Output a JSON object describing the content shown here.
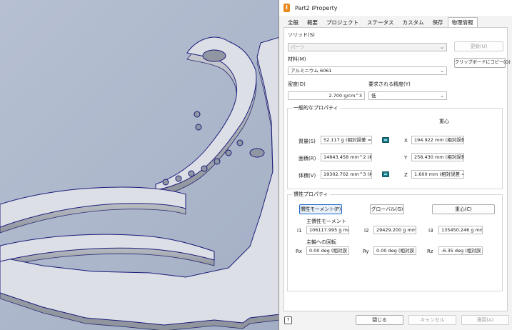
{
  "window": {
    "app_icon": "inventor-logo",
    "title": "Part2 iProperty"
  },
  "tabs": [
    {
      "label": "全般"
    },
    {
      "label": "概要"
    },
    {
      "label": "プロジェクト"
    },
    {
      "label": "ステータス"
    },
    {
      "label": "カスタム"
    },
    {
      "label": "保存"
    },
    {
      "label": "物理情報",
      "active": true
    }
  ],
  "physical": {
    "solid_label": "ソリッド(S)",
    "solid_value": "パーツ",
    "update_button": "更新(U)",
    "copy_button": "クリップボードにコピー(O)",
    "material_label": "材料(M)",
    "material_value": "アルミニウム 6061",
    "density_label": "密度(D)",
    "density_value": "2.700 g/cm^3",
    "accuracy_label": "要求される精度(Y)",
    "accuracy_value": "低"
  },
  "general": {
    "title": "一般的なプロパティ",
    "cg_label": "重心",
    "mass_label": "質量(S)",
    "mass_value": "52.117 g (相対誤差 =",
    "area_label": "面積(R)",
    "area_value": "14843.458 mm^2 (相対",
    "volume_label": "体積(V)",
    "volume_value": "19302.702 mm^3 (相対",
    "x_label": "X",
    "x_value": "194.922 mm (相対誤差",
    "y_label": "Y",
    "y_value": "258.430 mm (相対誤差",
    "z_label": "Z",
    "z_value": "1.600 mm (相対誤差 ="
  },
  "inertia": {
    "title": "慣性プロパティ",
    "principal_button": "慣性モーメント(P)",
    "global_button": "グローバル(G)",
    "cg_button": "重心(C)",
    "principal_moments_label": "主慣性モーメント",
    "i1_label": "I1",
    "i1_value": "106117.995 g mm",
    "i2_label": "I2",
    "i2_value": "29429.200 g mm^",
    "i3_label": "I3",
    "i3_value": "135450.246 g mm",
    "rotation_label": "主軸への回転",
    "rx_label": "Rx",
    "rx_value": "0.00 deg (相対誤",
    "ry_label": "Ry",
    "ry_value": "0.00 deg (相対誤",
    "rz_label": "Rz",
    "rz_value": "-6.35 deg (相対誤"
  },
  "footer": {
    "help_icon": "help-icon",
    "help_glyph": "?",
    "close_button": "閉じる",
    "cancel_button": "キャンセル",
    "apply_button": "適用(A)"
  },
  "colors": {
    "accent": "#1b67c8",
    "viewport_bg": "#a8b3c8",
    "part_face": "#d9dce2",
    "part_edge": "#1c1c7a"
  }
}
